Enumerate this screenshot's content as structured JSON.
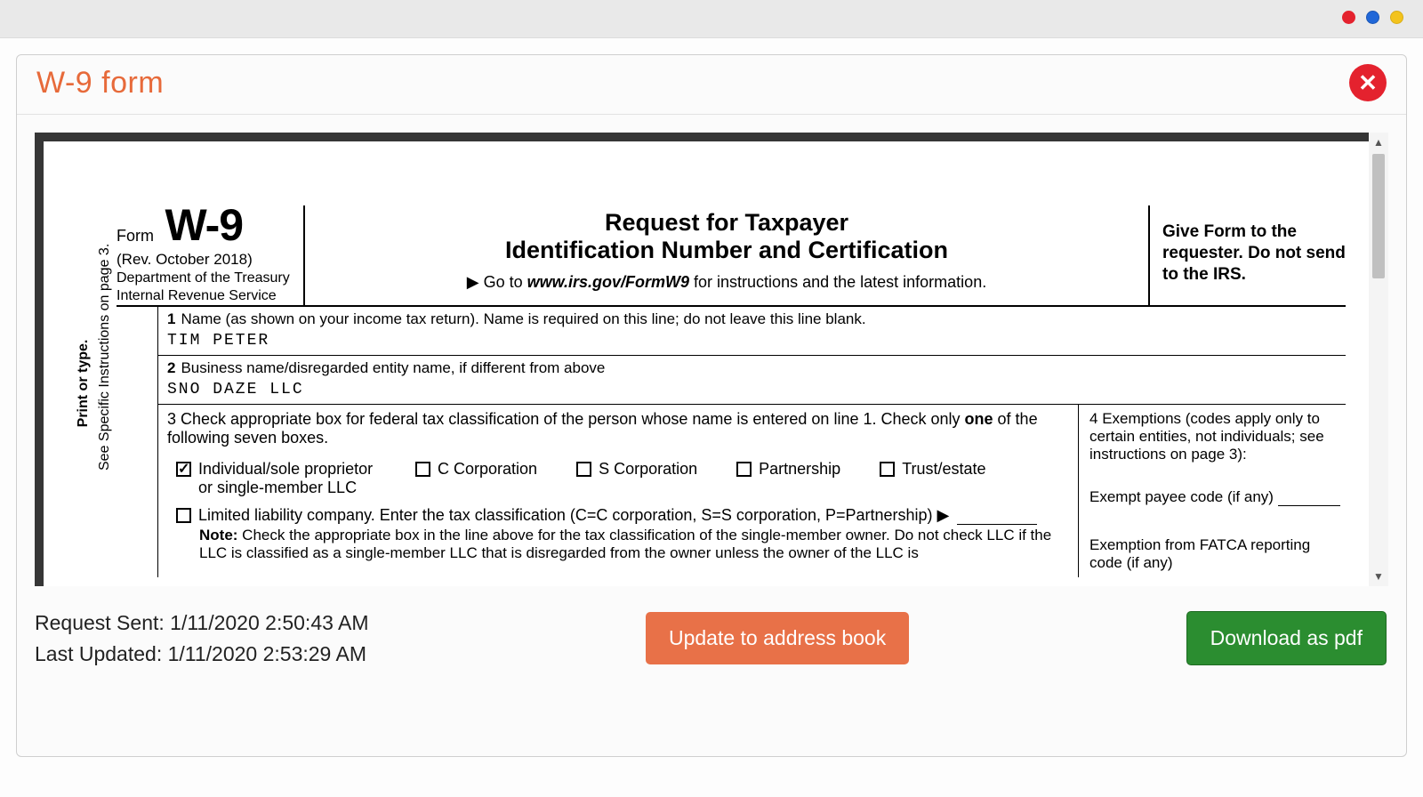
{
  "modal": {
    "title": "W-9 form",
    "close_icon": "✕"
  },
  "footer": {
    "request_sent_label": "Request Sent:",
    "request_sent_value": "1/11/2020 2:50:43 AM",
    "last_updated_label": "Last Updated:",
    "last_updated_value": "1/11/2020 2:53:29 AM",
    "update_button": "Update to address book",
    "download_button": "Download as pdf"
  },
  "form": {
    "form_label": "Form",
    "form_code": "W-9",
    "revision": "(Rev. October 2018)",
    "department": "Department of the Treasury",
    "irs": "Internal Revenue Service",
    "title_line1": "Request for Taxpayer",
    "title_line2": "Identification Number and Certification",
    "goto_prefix": "▶ Go to ",
    "goto_url": "www.irs.gov/FormW9",
    "goto_suffix": " for instructions and the latest information.",
    "give_form": "Give Form to the requester. Do not send to the IRS.",
    "side_inner": "Print or type.",
    "side_outer": "See Specific Instructions on page 3.",
    "line1_label": "Name (as shown on your income tax return). Name is required on this line; do not leave this line blank.",
    "line1_value": "TIM  PETER",
    "line2_label": "Business name/disregarded entity name, if different from above",
    "line2_value": "SNO DAZE LLC",
    "line3_label_a": "Check appropriate box for federal tax classification of the person whose name is entered on line 1. Check only ",
    "line3_label_bold": "one",
    "line3_label_b": " of the following seven boxes.",
    "chk_individual": "Individual/sole proprietor or single-member LLC",
    "chk_ccorp": "C Corporation",
    "chk_scorp": "S Corporation",
    "chk_partnership": "Partnership",
    "chk_trust": "Trust/estate",
    "chk_llc": "Limited liability company. Enter the tax classification (C=C corporation, S=S corporation, P=Partnership) ▶",
    "note_label": "Note:",
    "note_text": " Check the appropriate box in the line above for the tax classification of the single-member owner.  Do not check LLC if the LLC is classified as a single-member LLC that is disregarded from the owner unless the owner of the LLC is",
    "line4_label": "Exemptions (codes apply only to certain entities, not individuals; see instructions on page 3):",
    "exempt_payee": "Exempt payee code (if any)",
    "exempt_fatca": "Exemption from FATCA reporting code (if any)"
  }
}
